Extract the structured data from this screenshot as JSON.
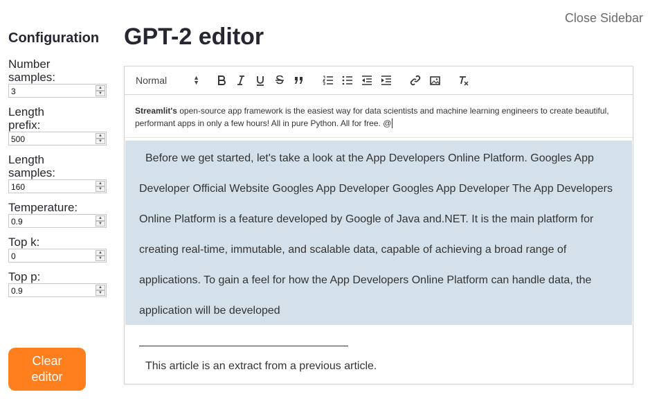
{
  "header": {
    "close_sidebar": "Close Sidebar",
    "title": "GPT-2 editor"
  },
  "sidebar": {
    "title": "Configuration",
    "fields": [
      {
        "label": "Number samples:",
        "value": "3"
      },
      {
        "label": "Length prefix:",
        "value": "500"
      },
      {
        "label": "Length samples:",
        "value": "160"
      },
      {
        "label": "Temperature:",
        "value": "0.9"
      },
      {
        "label": "Top k:",
        "value": "0"
      },
      {
        "label": "Top p:",
        "value": "0.9"
      }
    ],
    "clear_button": "Clear editor"
  },
  "toolbar": {
    "format": "Normal"
  },
  "editor": {
    "prompt_bold": "Streamlit's",
    "prompt_rest": " open-source app framework is the easiest way for data scientists and machine learning engineers to create beautiful, performant apps in only a few hours! All in pure Python. All for free. @",
    "generated_lines": [
      "Before we get started, let's take a look at the App Developers Online Platform. Googles App",
      "Developer Official Website Googles App Developer Googles App Developer The App Developers",
      "Online Platform is a feature developed by Google of Java and.NET. It is the main platform for",
      "creating real-time, immutable, and scalable data, capable of achieving a broad range of",
      "applications. To gain a feel for how the App Developers Online Platform can handle data, the",
      "application will be developed"
    ],
    "footer": "This article is an extract from a previous article."
  },
  "colors": {
    "accent": "#ff7f1e",
    "highlight": "#d4e1ea"
  }
}
